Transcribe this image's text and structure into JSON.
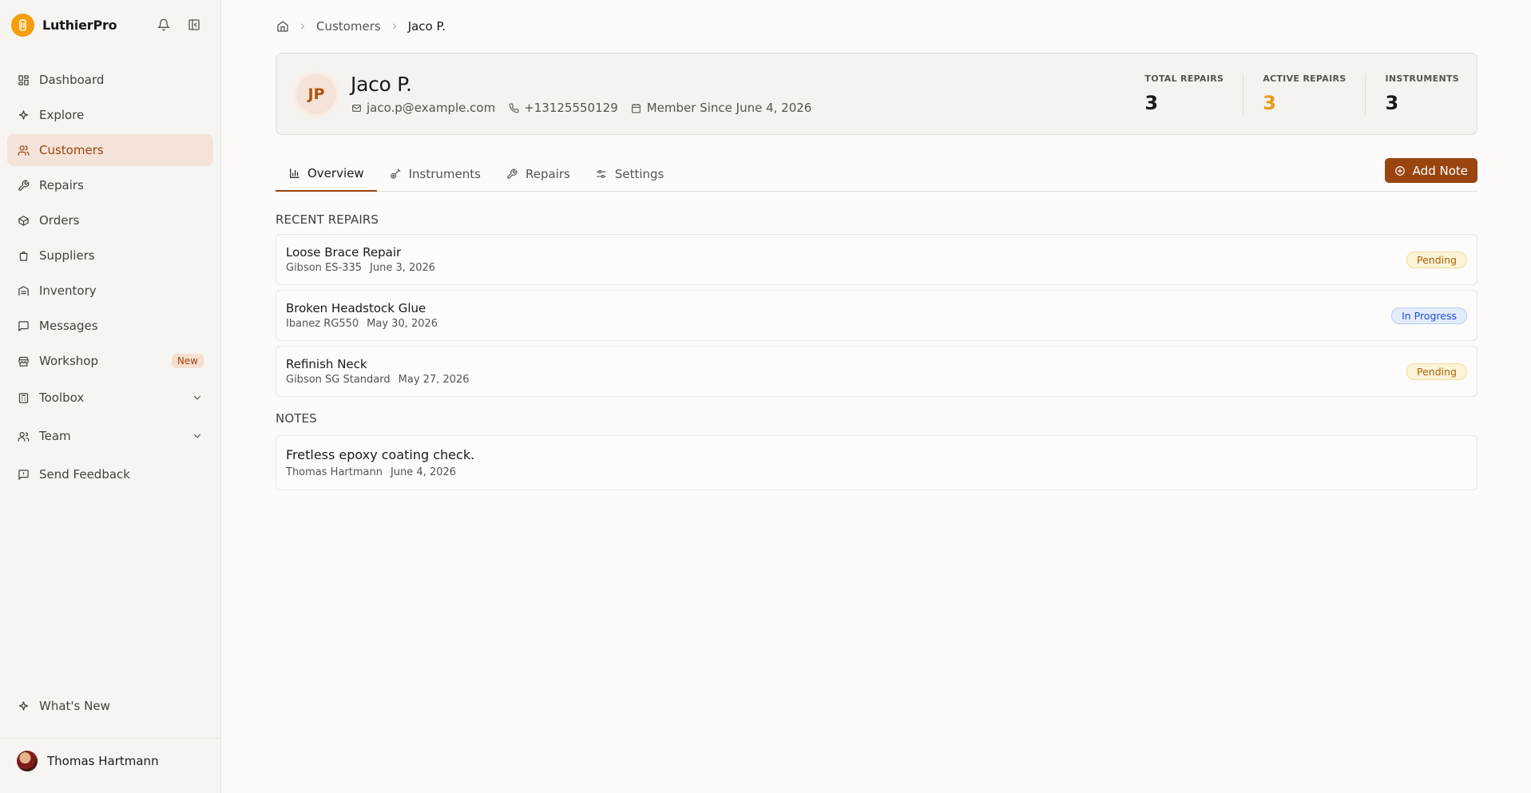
{
  "app": {
    "name": "LuthierPro"
  },
  "sidebar": {
    "items": [
      {
        "label": "Dashboard",
        "icon": "dashboard-icon"
      },
      {
        "label": "Explore",
        "icon": "sparkle-icon"
      },
      {
        "label": "Customers",
        "icon": "users-icon",
        "active": true
      },
      {
        "label": "Repairs",
        "icon": "wrench-icon"
      },
      {
        "label": "Orders",
        "icon": "package-icon"
      },
      {
        "label": "Suppliers",
        "icon": "shopping-bag-icon"
      },
      {
        "label": "Inventory",
        "icon": "warehouse-icon"
      },
      {
        "label": "Messages",
        "icon": "message-icon"
      },
      {
        "label": "Workshop",
        "icon": "store-icon",
        "badge": "New"
      },
      {
        "label": "Toolbox",
        "icon": "toolbox-icon"
      },
      {
        "label": "Team",
        "icon": "team-icon"
      },
      {
        "label": "Send Feedback",
        "icon": "feedback-icon"
      }
    ],
    "whats_new": "What's New",
    "user": {
      "name": "Thomas Hartmann"
    }
  },
  "breadcrumb": {
    "section": "Customers",
    "current": "Jaco P."
  },
  "profile": {
    "initials": "JP",
    "name": "Jaco P.",
    "email": "jaco.p@example.com",
    "phone": "+13125550129",
    "member_since": "Member Since June 4, 2026",
    "stats": {
      "total_repairs_label": "TOTAL REPAIRS",
      "total_repairs": "3",
      "active_repairs_label": "ACTIVE REPAIRS",
      "active_repairs": "3",
      "instruments_label": "INSTRUMENTS",
      "instruments": "3"
    }
  },
  "tabs": [
    "Overview",
    "Instruments",
    "Repairs",
    "Settings"
  ],
  "add_note_label": "Add Note",
  "recent_repairs_title": "RECENT REPAIRS",
  "repairs": [
    {
      "title": "Loose Brace Repair",
      "instrument": "Gibson ES-335",
      "date": "June 3, 2026",
      "status": "Pending"
    },
    {
      "title": "Broken Headstock Glue",
      "instrument": "Ibanez RG550",
      "date": "May 30, 2026",
      "status": "In Progress"
    },
    {
      "title": "Refinish Neck",
      "instrument": "Gibson SG Standard",
      "date": "May 27, 2026",
      "status": "Pending"
    }
  ],
  "notes_title": "NOTES",
  "notes": [
    {
      "text": "Fretless epoxy coating check.",
      "author": "Thomas Hartmann",
      "date": "June 4, 2026"
    }
  ],
  "colors": {
    "accent": "#9a4410",
    "logo": "#f59e0b",
    "active_stat": "#e79a1a"
  }
}
